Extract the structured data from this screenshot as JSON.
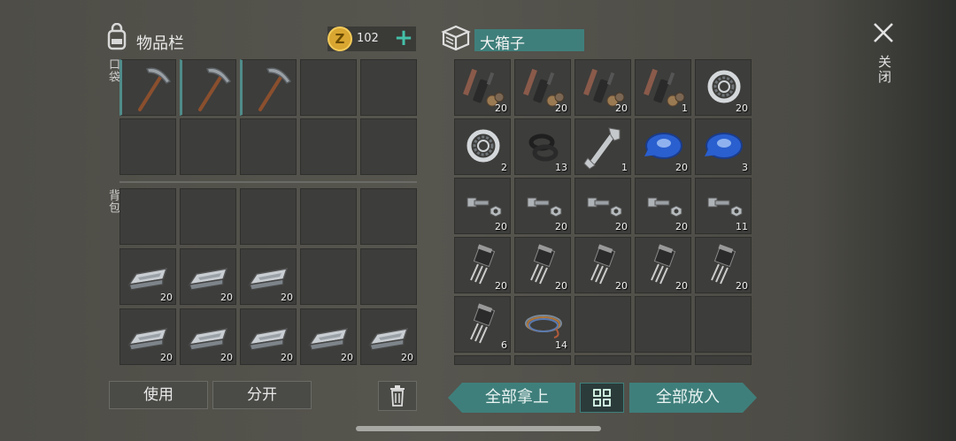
{
  "inventory": {
    "title": "物品栏",
    "coins": "102",
    "pocket_label": "口袋",
    "backpack_label": "背包",
    "pocket_slots": [
      {
        "icon": "pickaxe-icon",
        "count": "",
        "selected": true
      },
      {
        "icon": "pickaxe-icon",
        "count": "",
        "selected": true
      },
      {
        "icon": "pickaxe-icon",
        "count": "",
        "selected": true
      },
      {
        "icon": "",
        "count": ""
      },
      {
        "icon": "",
        "count": ""
      },
      {
        "icon": "",
        "count": ""
      },
      {
        "icon": "",
        "count": ""
      },
      {
        "icon": "",
        "count": ""
      },
      {
        "icon": "",
        "count": ""
      },
      {
        "icon": "",
        "count": ""
      }
    ],
    "backpack_slots": [
      {
        "icon": "",
        "count": ""
      },
      {
        "icon": "",
        "count": ""
      },
      {
        "icon": "",
        "count": ""
      },
      {
        "icon": "",
        "count": ""
      },
      {
        "icon": "",
        "count": ""
      },
      {
        "icon": "iron-ingot-icon",
        "count": "20"
      },
      {
        "icon": "iron-ingot-icon",
        "count": "20"
      },
      {
        "icon": "iron-ingot-icon",
        "count": "20"
      },
      {
        "icon": "",
        "count": ""
      },
      {
        "icon": "",
        "count": ""
      },
      {
        "icon": "iron-ingot-icon",
        "count": "20"
      },
      {
        "icon": "iron-ingot-icon",
        "count": "20"
      },
      {
        "icon": "iron-ingot-icon",
        "count": "20"
      },
      {
        "icon": "iron-ingot-icon",
        "count": "20"
      },
      {
        "icon": "iron-ingot-icon",
        "count": "20"
      }
    ],
    "use_label": "使用",
    "split_label": "分开"
  },
  "container": {
    "name": "大箱子",
    "slots": [
      {
        "icon": "spare-parts-icon",
        "count": "20"
      },
      {
        "icon": "spare-parts-icon",
        "count": "20"
      },
      {
        "icon": "spare-parts-icon",
        "count": "20"
      },
      {
        "icon": "spare-parts-icon",
        "count": "1"
      },
      {
        "icon": "bearing-icon",
        "count": "20"
      },
      {
        "icon": "bearing-icon",
        "count": "2"
      },
      {
        "icon": "rubber-gasket-icon",
        "count": "13"
      },
      {
        "icon": "wrench-icon",
        "count": "1"
      },
      {
        "icon": "blue-tape-icon",
        "count": "20"
      },
      {
        "icon": "blue-tape-icon",
        "count": "3"
      },
      {
        "icon": "bolt-nut-icon",
        "count": "20"
      },
      {
        "icon": "bolt-nut-icon",
        "count": "20"
      },
      {
        "icon": "bolt-nut-icon",
        "count": "20"
      },
      {
        "icon": "bolt-nut-icon",
        "count": "20"
      },
      {
        "icon": "bolt-nut-icon",
        "count": "11"
      },
      {
        "icon": "transistor-icon",
        "count": "20"
      },
      {
        "icon": "transistor-icon",
        "count": "20"
      },
      {
        "icon": "transistor-icon",
        "count": "20"
      },
      {
        "icon": "transistor-icon",
        "count": "20"
      },
      {
        "icon": "transistor-icon",
        "count": "20"
      },
      {
        "icon": "transistor-icon",
        "count": "6"
      },
      {
        "icon": "wire-coil-icon",
        "count": "14"
      },
      {
        "icon": "",
        "count": ""
      },
      {
        "icon": "",
        "count": ""
      },
      {
        "icon": "",
        "count": ""
      }
    ],
    "take_all_label": "全部拿上",
    "put_all_label": "全部放入"
  },
  "close_label": "关闭",
  "colors": {
    "accent_teal": "#3f7f7b",
    "slot_bg": "#3d3d3b",
    "coin_gold": "#d8a631"
  }
}
